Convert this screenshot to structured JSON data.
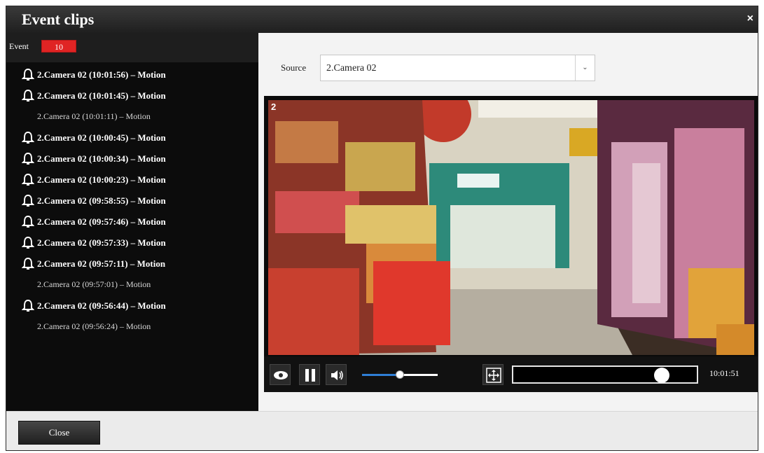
{
  "dialog": {
    "title": "Event clips",
    "close_glyph": "×"
  },
  "sidebar": {
    "event_label": "Event",
    "event_count": "10",
    "events": [
      {
        "label": "2.Camera 02 (10:01:56) – Motion",
        "has_bell": true
      },
      {
        "label": "2.Camera 02 (10:01:45) – Motion",
        "has_bell": true
      },
      {
        "label": "2.Camera 02 (10:01:11) – Motion",
        "has_bell": false
      },
      {
        "label": "2.Camera 02 (10:00:45) – Motion",
        "has_bell": true
      },
      {
        "label": "2.Camera 02 (10:00:34) – Motion",
        "has_bell": true
      },
      {
        "label": "2.Camera 02 (10:00:23) – Motion",
        "has_bell": true
      },
      {
        "label": "2.Camera 02 (09:58:55) – Motion",
        "has_bell": true
      },
      {
        "label": "2.Camera 02 (09:57:46) – Motion",
        "has_bell": true
      },
      {
        "label": "2.Camera 02 (09:57:33) – Motion",
        "has_bell": true
      },
      {
        "label": "2.Camera 02 (09:57:11) – Motion",
        "has_bell": true
      },
      {
        "label": "2.Camera 02 (09:57:01) – Motion",
        "has_bell": false
      },
      {
        "label": "2.Camera 02 (09:56:44) – Motion",
        "has_bell": true
      },
      {
        "label": "2.Camera 02 (09:56:24) – Motion",
        "has_bell": false
      }
    ]
  },
  "source": {
    "label": "Source",
    "value": "2.Camera 02",
    "arrow_glyph": "⌄"
  },
  "player": {
    "camera_number": "2",
    "volume_level": 0.5,
    "playback_position": 0.81,
    "time": "10:01:51",
    "icons": [
      "eye-icon",
      "pause-icon",
      "speaker-icon",
      "fullscreen-icon"
    ]
  },
  "footer": {
    "close_label": "Close"
  },
  "colors": {
    "titlebar": "#2a2a2a",
    "badge": "#e02424",
    "sidebar_bg": "#0c0c0c",
    "volume_fill": "#2f7fd6"
  }
}
